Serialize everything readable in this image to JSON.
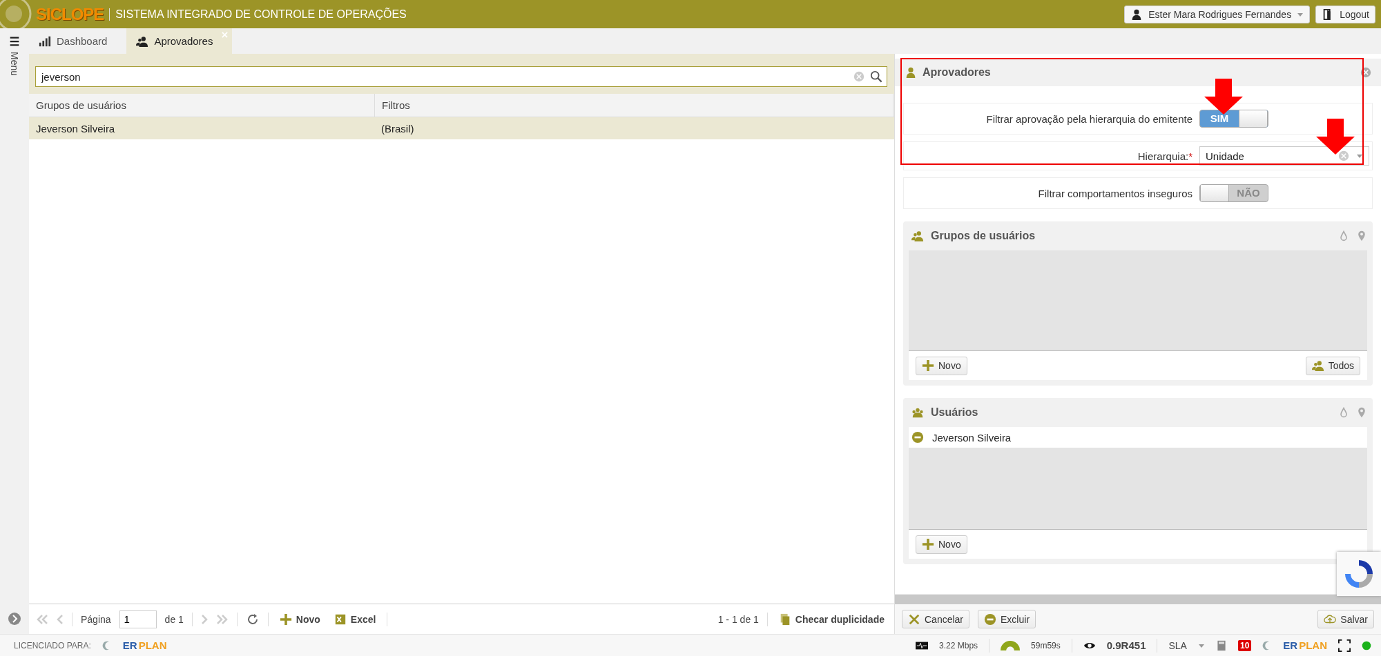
{
  "header": {
    "brand": "SICLOPE",
    "subtitle": "SISTEMA INTEGRADO DE CONTROLE DE OPERAÇÕES",
    "user": "Ester Mara Rodrigues Fernandes",
    "logout": "Logout"
  },
  "sidebar": {
    "label": "Menu"
  },
  "tabs": [
    {
      "label": "Dashboard",
      "selected": false,
      "closable": false
    },
    {
      "label": "Aprovadores",
      "selected": true,
      "closable": true
    }
  ],
  "search": {
    "value": "jeverson"
  },
  "table": {
    "columns": [
      "Grupos de usuários",
      "Filtros"
    ],
    "rows": [
      {
        "cells": [
          "Jeverson Silveira",
          "(Brasil)"
        ],
        "selected": true
      }
    ]
  },
  "pager": {
    "page_label": "Página",
    "page": "1",
    "of": "de 1",
    "new": "Novo",
    "excel": "Excel",
    "range": "1 - 1 de 1",
    "duplicates": "Checar duplicidade"
  },
  "form": {
    "title": "Aprovadores",
    "rows": [
      {
        "kind": "toggle",
        "label": "Filtrar aprovação pela hierarquia do emitente",
        "on": true,
        "state_label": "SIM"
      },
      {
        "kind": "select",
        "label": "Hierarquia:",
        "required_mark": "*",
        "value": "Unidade"
      },
      {
        "kind": "toggle",
        "label": "Filtrar comportamentos inseguros",
        "on": false,
        "state_label": "NÃO"
      }
    ],
    "groups": {
      "title": "Grupos de usuários",
      "new": "Novo",
      "all": "Todos"
    },
    "users": {
      "title": "Usuários",
      "items": [
        "Jeverson Silveira"
      ],
      "new": "Novo"
    },
    "actions": {
      "cancel": "Cancelar",
      "delete": "Excluir",
      "save": "Salvar"
    }
  },
  "annotations": [
    {
      "kind": "highlight_box"
    },
    {
      "kind": "arrow"
    },
    {
      "kind": "arrow"
    }
  ],
  "status_bar": {
    "licensed": "LICENCIADO PARA:",
    "logo_a": "ER",
    "logo_b": "PLAN",
    "logo2_a": "ER",
    "logo2_b": "PLAN",
    "speed": "3.22 Mbps",
    "timer": "59m59s",
    "version": "0.9R451",
    "sla": "SLA",
    "alerts": "10"
  }
}
